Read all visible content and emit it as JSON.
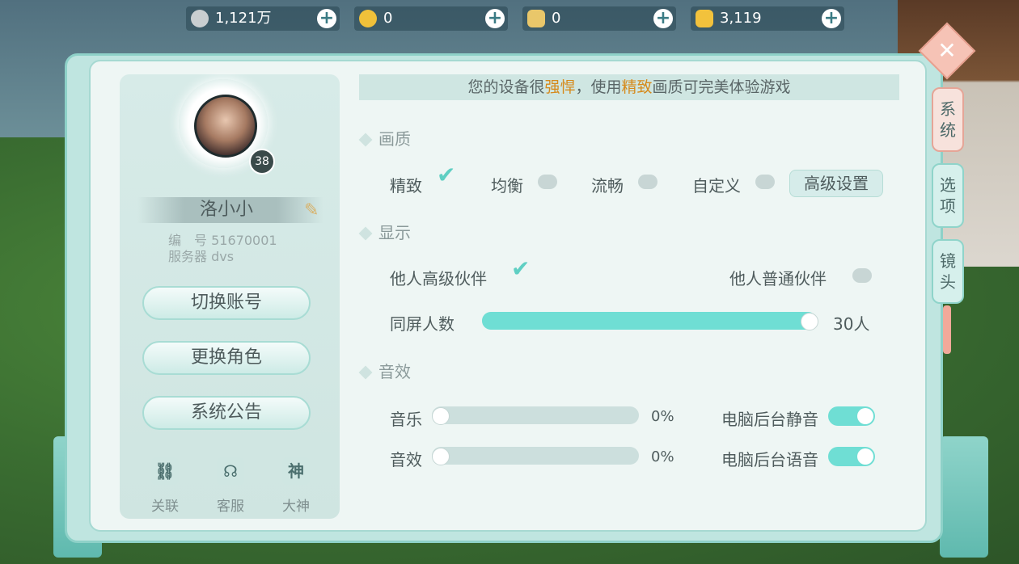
{
  "currencies": [
    {
      "icon": "silver-coin-icon",
      "value": "1,121万",
      "color": "#c9ced0"
    },
    {
      "icon": "gold-coin-icon",
      "value": "0",
      "color": "#f0c13a"
    },
    {
      "icon": "bound-ingot-icon",
      "value": "0",
      "color": "#e9c76a"
    },
    {
      "icon": "gold-ingot-icon",
      "value": "3,119",
      "color": "#f2c23c"
    }
  ],
  "profile": {
    "name": "洛小小",
    "level": "38",
    "id_label": "编　号",
    "id_value": "51670001",
    "server_label": "服务器",
    "server_value": "dvs"
  },
  "left_buttons": {
    "switch_account": "切换账号",
    "change_role": "更换角色",
    "system_notice": "系统公告"
  },
  "shortcuts": [
    {
      "icon": "link-icon",
      "glyph": "⛓",
      "label": "关联"
    },
    {
      "icon": "support-icon",
      "glyph": "☊",
      "label": "客服"
    },
    {
      "icon": "dashen-icon",
      "glyph": "神",
      "label": "大神"
    }
  ],
  "banner": {
    "prefix": "您的设备很",
    "hl1": "强悍",
    "mid": "，使用",
    "hl2": "精致",
    "suffix": "画质可完美体验游戏"
  },
  "quality": {
    "title": "画质",
    "options": [
      "精致",
      "均衡",
      "流畅",
      "自定义"
    ],
    "selected": "精致",
    "advanced": "高级设置"
  },
  "display": {
    "title": "显示",
    "partner_advanced": "他人高级伙伴",
    "partner_advanced_checked": true,
    "partner_normal": "他人普通伙伴",
    "partner_normal_checked": false,
    "same_screen_label": "同屏人数",
    "same_screen_value": "30人",
    "same_screen_fraction": 1.0
  },
  "audio": {
    "title": "音效",
    "music_label": "音乐",
    "music_value": "0%",
    "sfx_label": "音效",
    "sfx_value": "0%",
    "bg_mute_label": "电脑后台静音",
    "bg_mute_on": true,
    "bg_voice_label": "电脑后台语音",
    "bg_voice_on": true
  },
  "side_tabs": [
    {
      "label": "系统",
      "active": true
    },
    {
      "label": "选项",
      "active": false
    },
    {
      "label": "镜头",
      "active": false
    }
  ],
  "close_symbol": "✕",
  "accent_color": "#6fded4"
}
